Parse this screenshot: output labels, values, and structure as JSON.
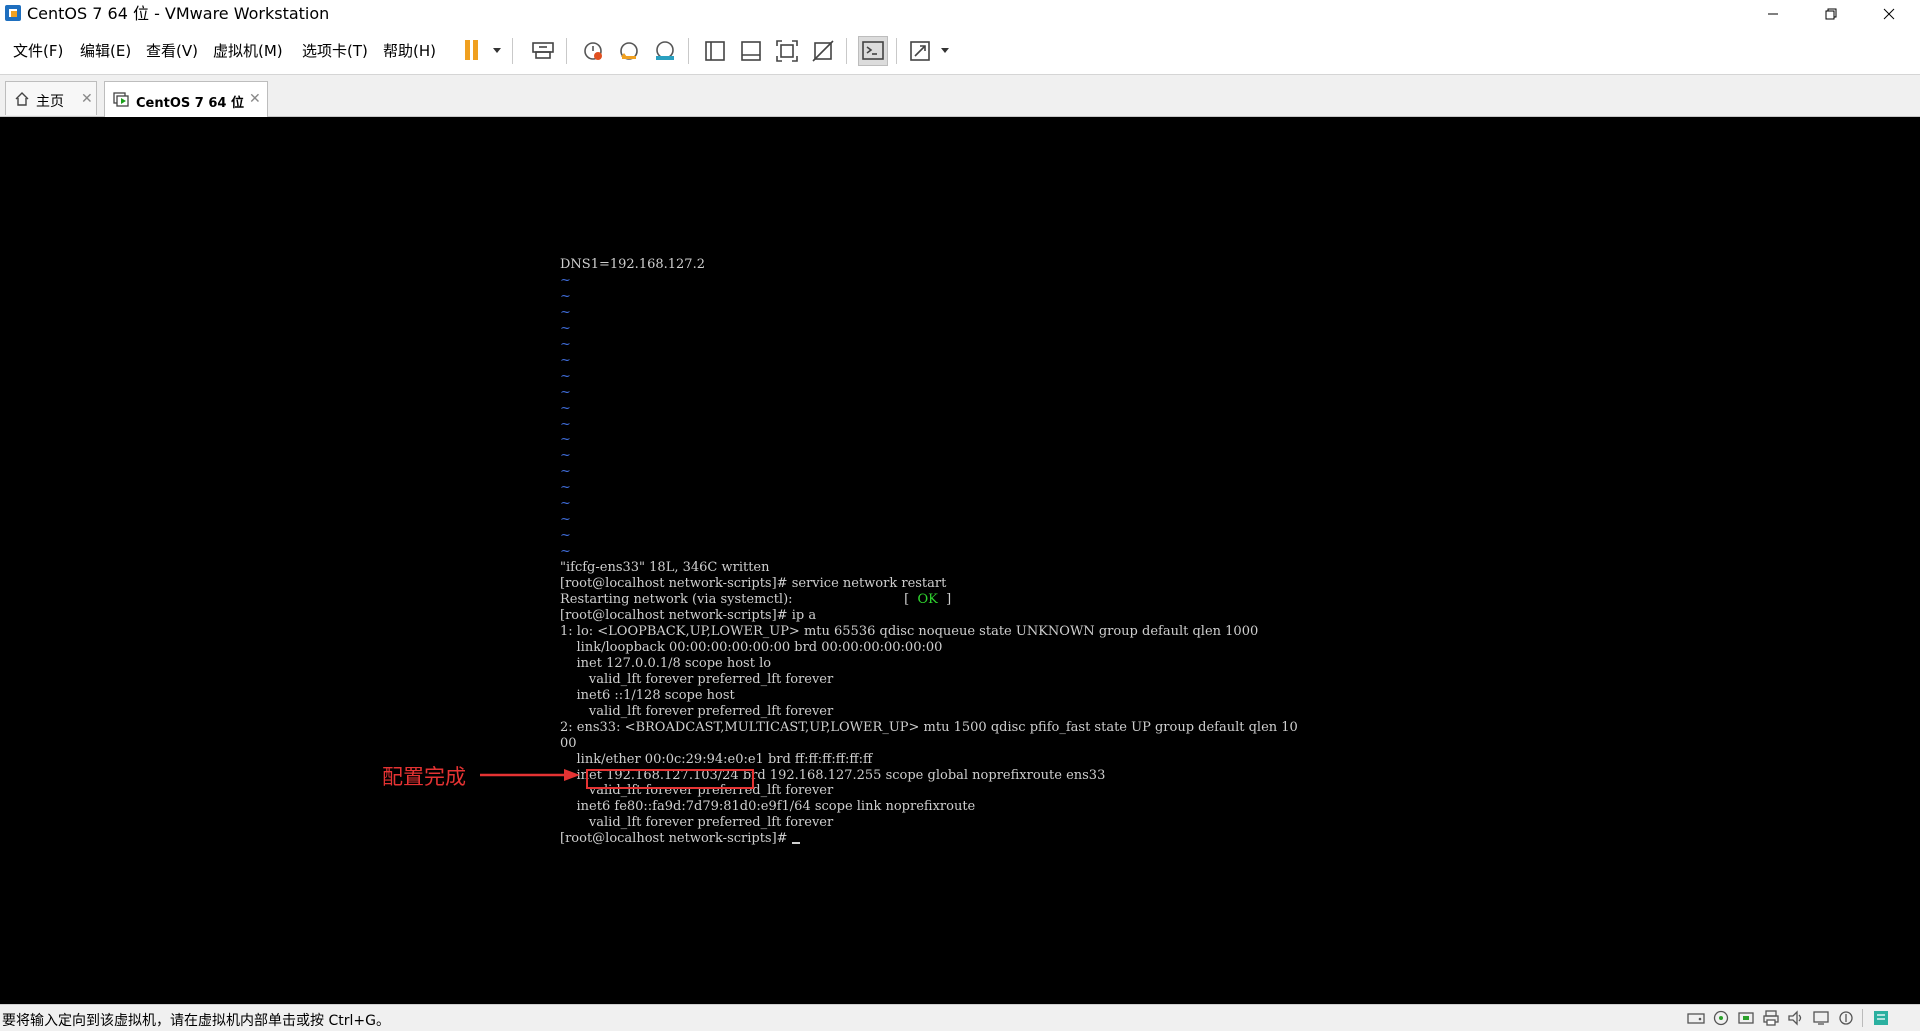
{
  "window": {
    "title": "CentOS 7 64 位 - VMware Workstation"
  },
  "menu": [
    {
      "label": "文件(F)"
    },
    {
      "label": "编辑(E)"
    },
    {
      "label": "查看(V)"
    },
    {
      "label": "虚拟机(M)"
    },
    {
      "label": "选项卡(T)"
    },
    {
      "label": "帮助(H)"
    }
  ],
  "tabs": [
    {
      "label": "主页",
      "icon": "home-icon"
    },
    {
      "label": "CentOS 7 64 位",
      "icon": "vm-running-icon"
    }
  ],
  "terminal": {
    "first_line": "DNS1=192.168.127.2",
    "tilde_char": "~",
    "tilde_count": 18,
    "written": "\"ifcfg-ens33\" 18L, 346C written",
    "cmd1": "[root@localhost network-scripts]# service network restart",
    "restart_msg": "Restarting network (via systemctl):",
    "ok_open": "[  ",
    "ok_text": "OK",
    "ok_close": "  ]",
    "cmd2": "[root@localhost network-scripts]# ip a",
    "lo_line": "1: lo: <LOOPBACK,UP,LOWER_UP> mtu 65536 qdisc noqueue state UNKNOWN group default qlen 1000",
    "lo_link": "    link/loopback 00:00:00:00:00:00 brd 00:00:00:00:00:00",
    "lo_inet": "    inet 127.0.0.1/8 scope host lo",
    "lo_valid1": "       valid_lft forever preferred_lft forever",
    "lo_inet6": "    inet6 ::1/128 scope host",
    "lo_valid2": "       valid_lft forever preferred_lft forever",
    "ens_line1": "2: ens33: <BROADCAST,MULTICAST,UP,LOWER_UP> mtu 1500 qdisc pfifo_fast state UP group default qlen 10",
    "ens_line2": "00",
    "ens_link": "    link/ether 00:0c:29:94:e0:e1 brd ff:ff:ff:ff:ff:ff",
    "ens_inet": "    inet 192.168.127.103/24 brd 192.168.127.255 scope global noprefixroute ens33",
    "ens_valid1": "       valid_lft forever preferred_lft forever",
    "ens_inet6": "    inet6 fe80::fa9d:7d79:81d0:e9f1/64 scope link noprefixroute",
    "ens_valid2": "       valid_lft forever preferred_lft forever",
    "prompt": "[root@localhost network-scripts]# "
  },
  "annotation": {
    "text": "配置完成",
    "color": "#e53333"
  },
  "status": {
    "hint": "要将输入定向到该虚拟机，请在虚拟机内部单击或按 Ctrl+G。"
  },
  "colors": {
    "accent_orange": "#f0a020",
    "console_bg": "#000000",
    "tilde": "#3e6bd6",
    "ok": "#2fd52f"
  }
}
